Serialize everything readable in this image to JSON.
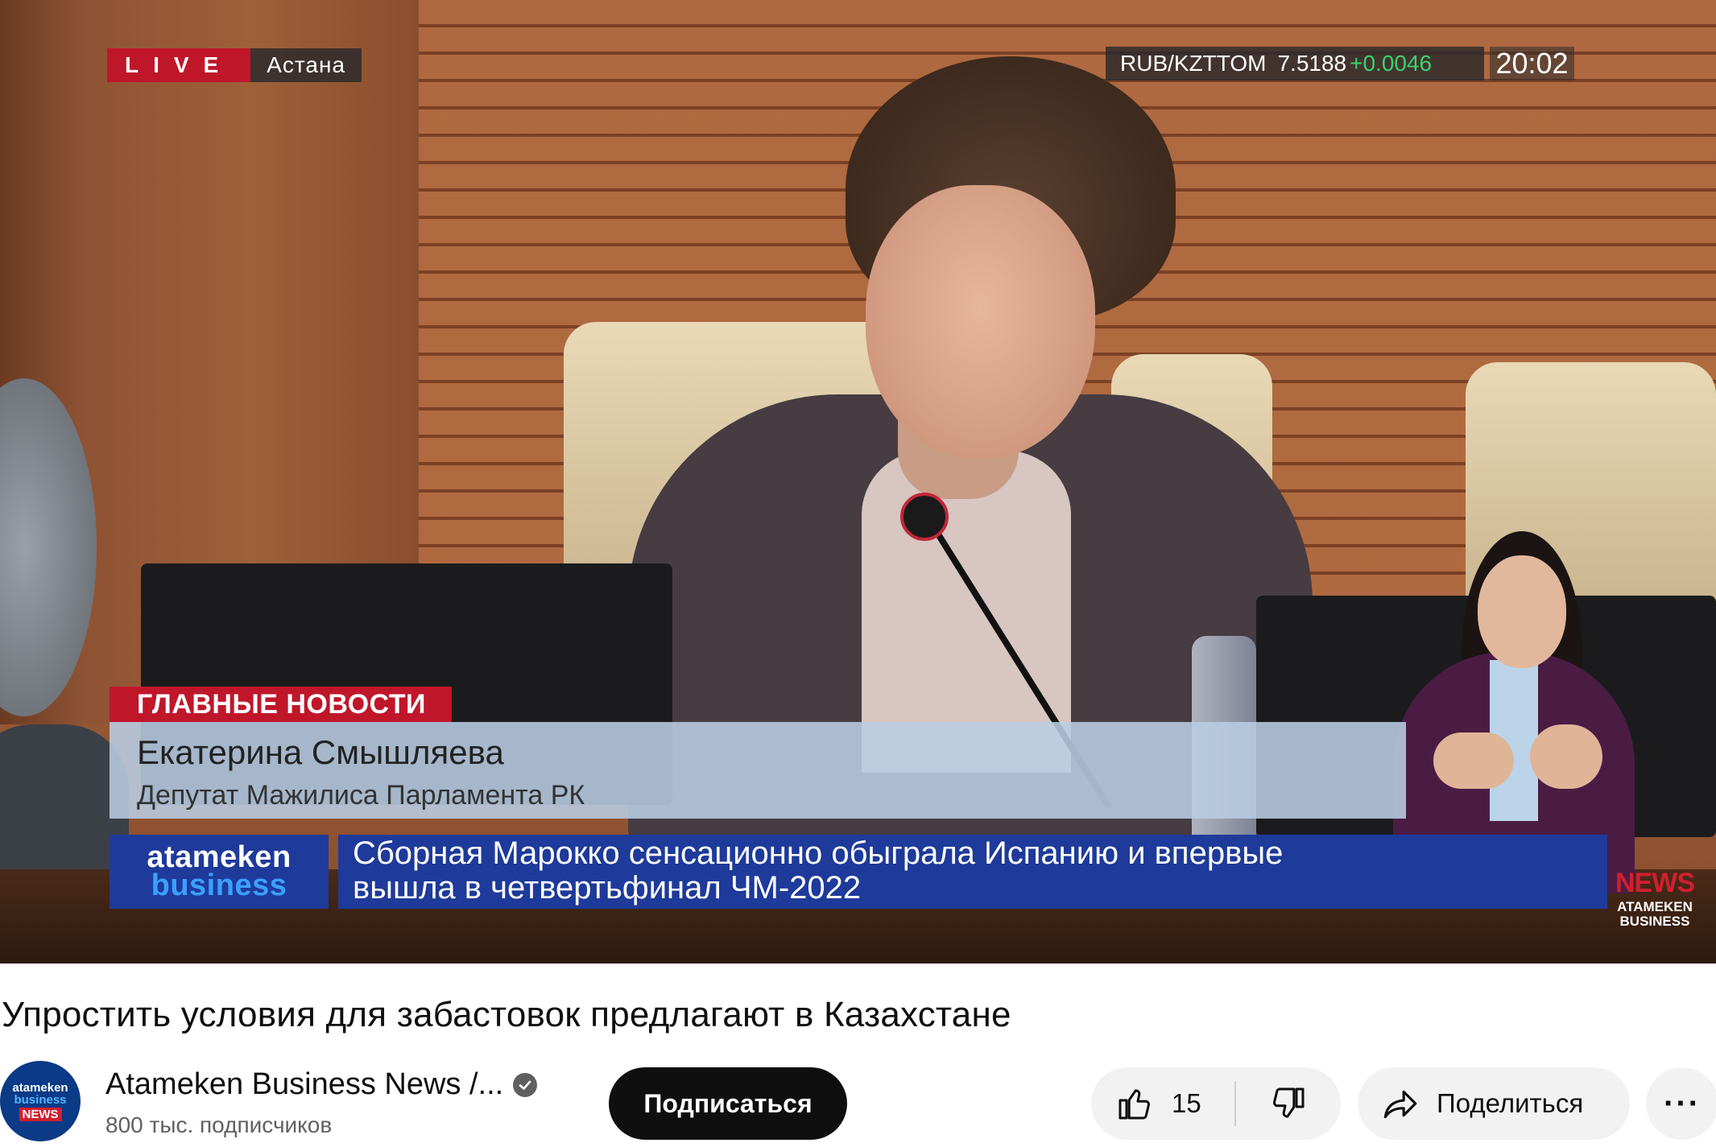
{
  "video": {
    "live_label": "LIVE",
    "live_city": "Астана",
    "ticker": {
      "pair": "RUB/KZTTOM",
      "rate": "7.5188",
      "delta": "+0.0046"
    },
    "clock": "20:02",
    "section_tag": "ГЛАВНЫЕ НОВОСТИ",
    "speaker_name": "Екатерина Смышляева",
    "speaker_title": "Депутат Мажилиса Парламента  РК",
    "brand_top": "atameken",
    "brand_bottom": "business",
    "headline_line1": "Сборная Марокко сенсационно обыграла Испанию и впервые",
    "headline_line2": "вышла в четвертьфинал ЧМ-2022",
    "corner_logo_main": "NEWS",
    "corner_logo_sub1": "ATAMEKEN",
    "corner_logo_sub2": "BUSINESS"
  },
  "title": "Упростить условия для забастовок предлагают в Казахстане",
  "channel": {
    "avatar_line1": "atameken",
    "avatar_line2": "business",
    "avatar_line3": "NEWS",
    "name": "Atameken Business News /...",
    "subscribers": "800 тыс. подписчиков",
    "subscribe_label": "Подписаться"
  },
  "actions": {
    "like_count": "15",
    "share_label": "Поделиться",
    "more_label": "···"
  },
  "colors": {
    "live_red": "#c0162a",
    "brand_blue": "#1e3a9a",
    "ticker_green": "#3ad36a",
    "subscribe_bg": "#0f0f0f",
    "pill_bg": "#f2f2f2"
  },
  "icons": [
    "verified-icon",
    "thumbs-up-icon",
    "thumbs-down-icon",
    "share-arrow-icon",
    "more-dots-icon"
  ]
}
